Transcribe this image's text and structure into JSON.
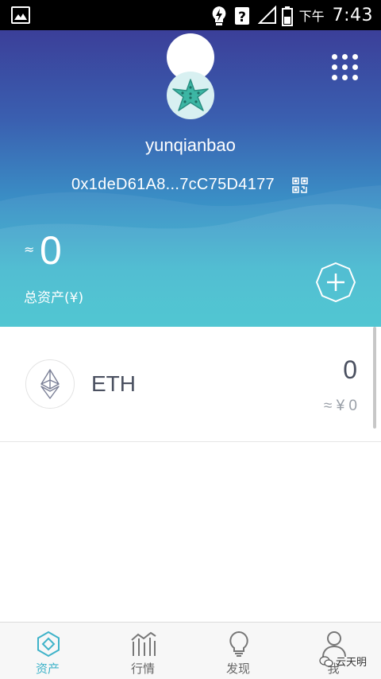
{
  "status_bar": {
    "time": "7:43",
    "period": "下午",
    "icons": [
      "image-icon",
      "lightning-notification-icon",
      "unknown-notification-icon",
      "signal-icon",
      "battery-icon"
    ]
  },
  "header": {
    "wallet_name": "yunqianbao",
    "wallet_address": "0x1deD61A8...7cC75D4177",
    "approx_symbol": "≈",
    "total_value": "0",
    "total_label": "总资产(¥)",
    "avatar_icon": "starfish-icon"
  },
  "assets": [
    {
      "symbol": "ETH",
      "amount": "0",
      "fiat": "≈ ¥ 0",
      "icon": "ethereum-icon"
    }
  ],
  "bottom_nav": {
    "items": [
      {
        "label": "资产",
        "icon": "assets-diamond-icon",
        "active": true
      },
      {
        "label": "行情",
        "icon": "market-chart-icon",
        "active": false
      },
      {
        "label": "发现",
        "icon": "discover-bulb-icon",
        "active": false
      },
      {
        "label": "我",
        "icon": "profile-person-icon",
        "active": false
      }
    ]
  },
  "watermark": "云天明",
  "colors": {
    "accent": "#3fb3c9",
    "header_top": "#3b3f99",
    "header_bottom": "#38bfcc"
  }
}
